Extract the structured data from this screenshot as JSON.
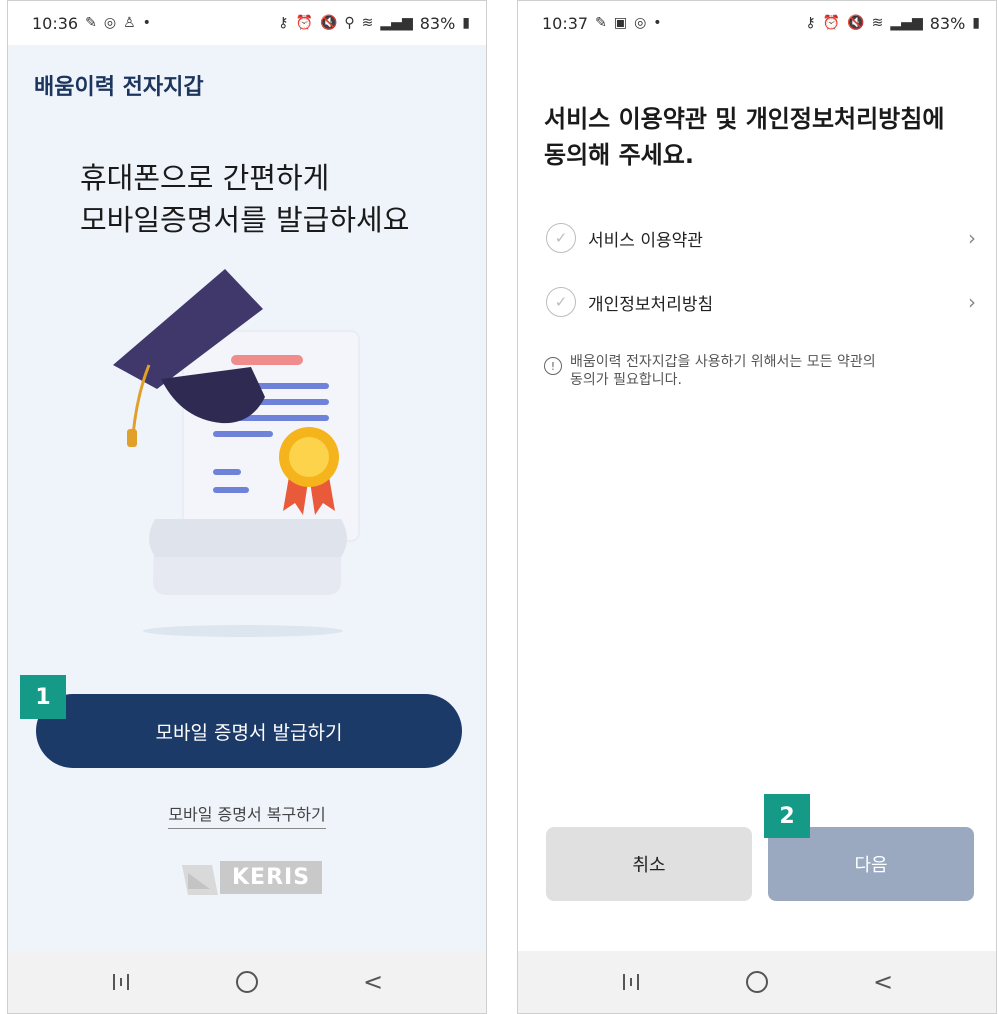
{
  "screen1": {
    "status": {
      "time": "10:36",
      "battery": "83%",
      "left_icons": [
        "pen-icon",
        "target-icon",
        "person-icon",
        "dot-icon"
      ],
      "right_icons": [
        "key-icon",
        "alarm-icon",
        "mute-icon",
        "location-icon",
        "wifi-icon",
        "hd-voice-icon",
        "signal-icon",
        "battery-icon"
      ]
    },
    "app_title": "배움이력 전자지갑",
    "headline_line1": "휴대폰으로 간편하게",
    "headline_line2": "모바일증명서를 발급하세요",
    "primary_button": "모바일 증명서 발급하기",
    "restore_link": "모바일 증명서 복구하기",
    "logo_text": "KERIS",
    "badge": "1"
  },
  "screen2": {
    "status": {
      "time": "10:37",
      "battery": "83%",
      "left_icons": [
        "pen-icon",
        "image-icon",
        "target-icon",
        "dot-icon"
      ],
      "right_icons": [
        "key-icon",
        "alarm-icon",
        "mute-icon",
        "wifi-icon",
        "hd-voice-icon",
        "signal-icon",
        "battery-icon"
      ]
    },
    "title_line1": "서비스 이용약관 및 개인정보처리방침에",
    "title_line2": "동의해 주세요.",
    "terms": [
      {
        "label": "서비스 이용약관"
      },
      {
        "label": "개인정보처리방침"
      }
    ],
    "notice_line1": "배움이력 전자지갑을 사용하기 위해서는 모든 약관의",
    "notice_line2": "동의가 필요합니다.",
    "cancel_button": "취소",
    "next_button": "다음",
    "badge": "2"
  },
  "colors": {
    "primary": "#1c3a68",
    "accent_badge": "#149a86",
    "disabled": "#9aa9c0"
  }
}
